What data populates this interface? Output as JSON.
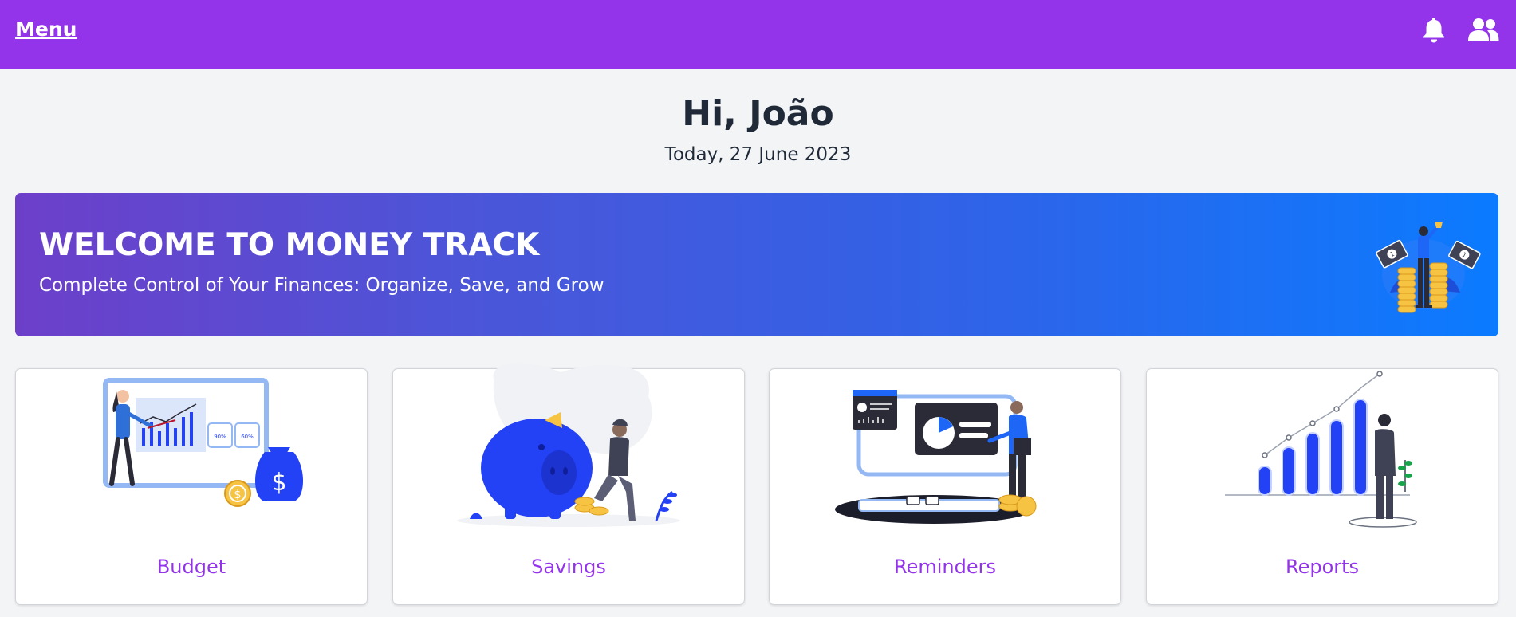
{
  "header": {
    "menu_label": "Menu",
    "icons": [
      "bell-icon",
      "users-icon"
    ]
  },
  "greeting": {
    "title": "Hi, João",
    "date": "Today, 27 June 2023"
  },
  "banner": {
    "title": "WELCOME TO MONEY TRACK",
    "subtitle": "Complete Control of Your Finances: Organize, Save, and Grow"
  },
  "cards": [
    {
      "label": "Budget"
    },
    {
      "label": "Savings"
    },
    {
      "label": "Reminders"
    },
    {
      "label": "Reports"
    }
  ],
  "colors": {
    "header_bg": "#9333ea",
    "accent": "#9333ea",
    "illustration_blue": "#2341f5",
    "page_bg": "#f3f4f6"
  }
}
